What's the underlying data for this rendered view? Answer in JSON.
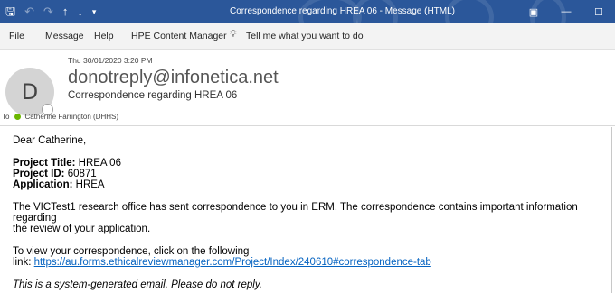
{
  "titlebar": {
    "title": "Correspondence regarding HREA 06  -  Message (HTML)",
    "colors": {
      "background": "#2b579a"
    },
    "quick_access": {
      "save_icon": "save-icon",
      "undo_icon": "undo-icon",
      "redo_icon": "redo-icon",
      "up_icon": "arrow-up-icon",
      "down_icon": "arrow-down-icon",
      "customize_icon": "chevron-down-icon"
    },
    "controls": {
      "ribbon_display_icon": "ribbon-display-icon",
      "minimize_icon": "minimize-icon",
      "maximize_icon": "maximize-icon"
    }
  },
  "ribbon": {
    "tabs": [
      "File",
      "Message",
      "Help",
      "HPE Content Manager"
    ],
    "tell_me": "Tell me what you want to do"
  },
  "message": {
    "date": "Thu 30/01/2020 3:20 PM",
    "avatar_initial": "D",
    "sender": "donotreply@infonetica.net",
    "subject": "Correspondence regarding HREA 06",
    "to_label": "To",
    "recipient": "Catherine Farrington (DHHS)",
    "presence_color": "#6bb700"
  },
  "body": {
    "greeting": "Dear Catherine,",
    "project_title_label": "Project Title:",
    "project_title": "HREA 06",
    "project_id_label": "Project ID:",
    "project_id": "60871",
    "application_label": "Application:",
    "application": "HREA",
    "paragraph1_line1": "The VICTest1 research office has sent correspondence to you in ERM. The correspondence contains important information regarding",
    "paragraph1_line2": "the review of your application.",
    "paragraph2_line1": "To view your correspondence, click on the following",
    "link_prefix": "link:",
    "link": "https://au.forms.ethicalreviewmanager.com/Project/Index/240610#correspondence-tab",
    "footer": "This is a system-generated email. Please do not reply."
  }
}
